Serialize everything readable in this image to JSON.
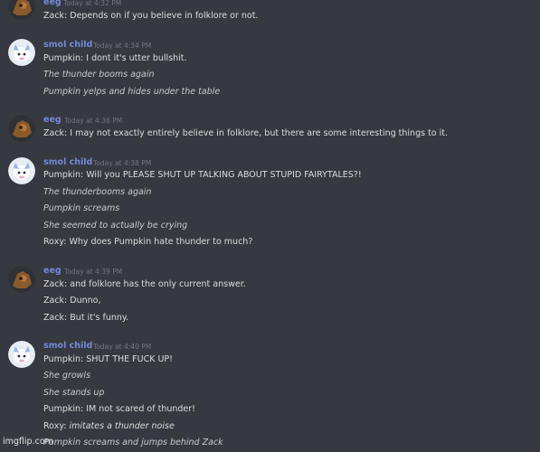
{
  "messages": [
    {
      "author": "eeg",
      "timestamp": "Today at 4:32 PM",
      "avatar": "brown-rock-avatar-icon",
      "lines": [
        {
          "text": "Zack: Depends on if you believe in folklore or not.",
          "italic": false
        }
      ]
    },
    {
      "author": "smol child",
      "timestamp": "Today at 4:34 PM",
      "avatar": "white-creature-avatar-icon",
      "lines": [
        {
          "text": "Pumpkin: I dont it's utter bullshit.",
          "italic": false
        },
        {
          "text": "The thunder booms again",
          "italic": true
        },
        {
          "text": "Pumpkin yelps and hides under the table",
          "italic": true
        }
      ]
    },
    {
      "author": "eeg",
      "timestamp": "Today at 4:36 PM",
      "avatar": "brown-rock-avatar-icon",
      "lines": [
        {
          "text": "Zack: I may not exactly entirely believe in folklore, but there are some interesting things to it.",
          "italic": false
        }
      ]
    },
    {
      "author": "smol child",
      "timestamp": "Today at 4:38 PM",
      "avatar": "white-creature-avatar-icon",
      "lines": [
        {
          "text": "Pumpkin: Will you PLEASE SHUT UP TALKING ABOUT STUPID FAIRYTALES?!",
          "italic": false
        },
        {
          "text": "The thunderbooms again",
          "italic": true
        },
        {
          "text": "Pumpkin screams",
          "italic": true
        },
        {
          "text": "She seemed to actually be crying",
          "italic": true
        },
        {
          "text": "Roxy: Why does Pumpkin hate thunder to much?",
          "italic": false
        }
      ]
    },
    {
      "author": "eeg",
      "timestamp": "Today at 4:39 PM",
      "avatar": "brown-rock-avatar-icon",
      "lines": [
        {
          "text": "Zack: and folklore has the only current answer.",
          "italic": false
        },
        {
          "text": "Zack: Dunno,",
          "italic": false
        },
        {
          "text": "Zack: But it's funny.",
          "italic": false
        }
      ]
    },
    {
      "author": "smol child",
      "timestamp": "Today at 4:40 PM",
      "avatar": "white-creature-avatar-icon",
      "lines": [
        {
          "text": "Pumpkin: SHUT THE FUCK UP!",
          "italic": false
        },
        {
          "text": "She growls",
          "italic": true
        },
        {
          "text": "She stands up",
          "italic": true
        },
        {
          "text": "Pumpkin: IM not scared of thunder!",
          "italic": false
        },
        {
          "text": "Roxy: imitates a thunder noise",
          "italic": false
        },
        {
          "text": "Pumpkin screams and jumps behind Zack",
          "italic": true
        }
      ]
    }
  ],
  "watermark": "imgflip.com",
  "colors": {
    "background": "#36393f",
    "username": "#7289da",
    "timestamp": "#72767d",
    "text": "#dcddde"
  }
}
